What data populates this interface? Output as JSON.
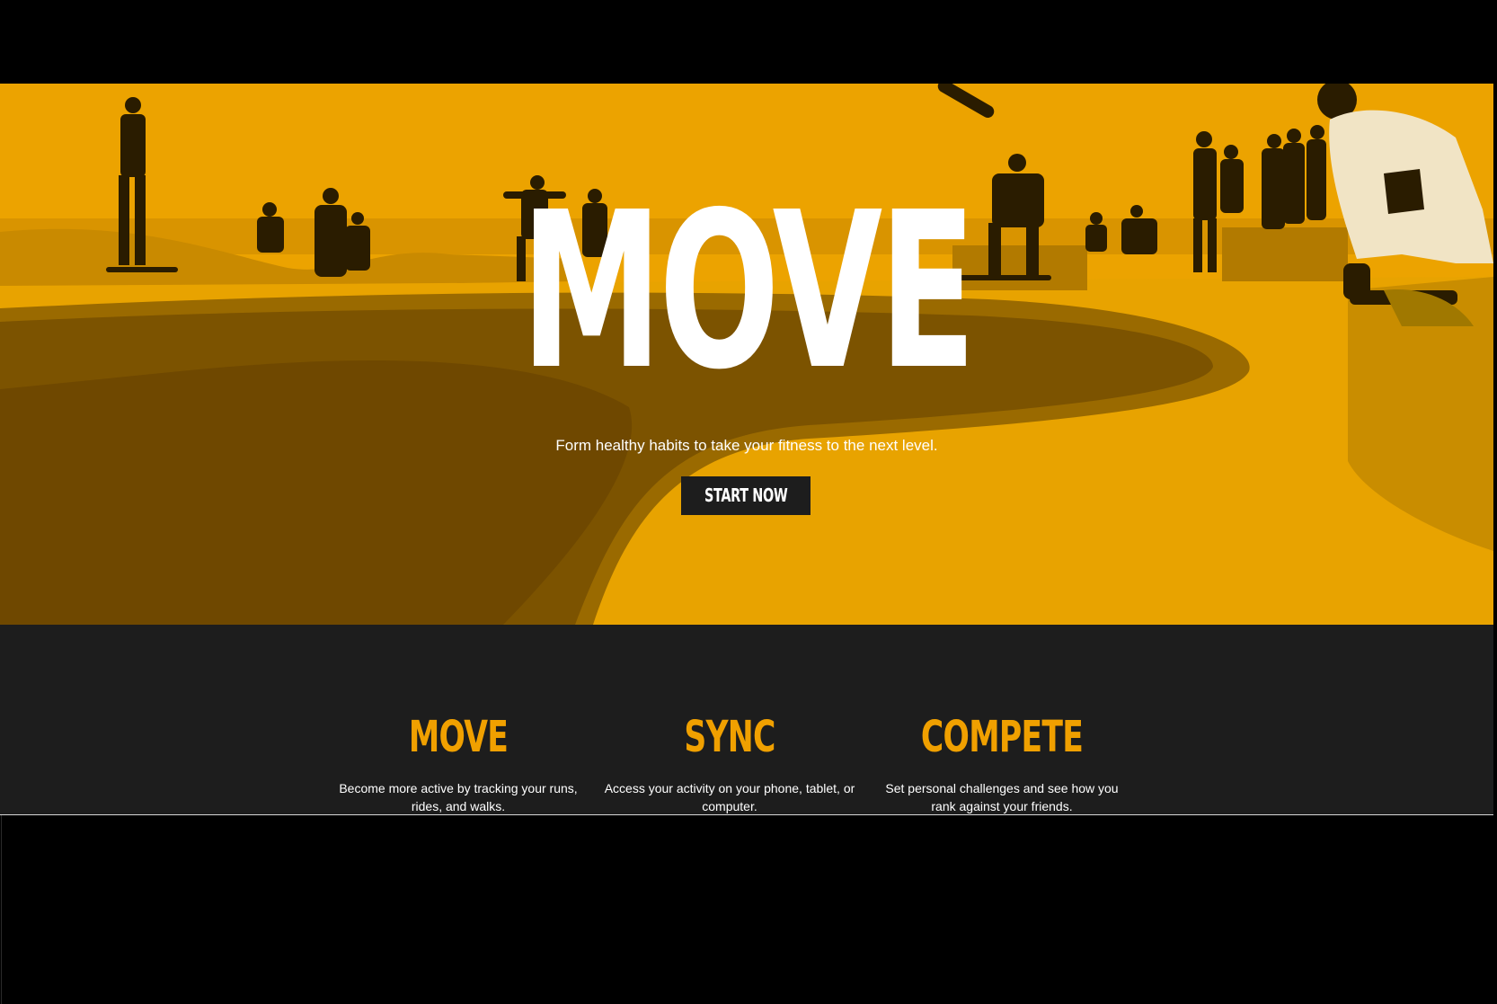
{
  "hero": {
    "title": "MOVE",
    "subtitle": "Form healthy habits to take your fitness to the next level.",
    "cta_label": "START NOW",
    "photo_description": "skate-park-crowd-photo",
    "tint_color": "#e9a000"
  },
  "features": [
    {
      "title": "MOVE",
      "description": "Become more active by tracking your runs, rides, and walks."
    },
    {
      "title": "SYNC",
      "description": "Access your activity on your phone, tablet, or computer."
    },
    {
      "title": "COMPETE",
      "description": "Set personal challenges and see how you rank against your friends."
    }
  ],
  "colors": {
    "accent": "#f0a000",
    "dark_panel": "#1d1d1d",
    "background": "#000000"
  }
}
